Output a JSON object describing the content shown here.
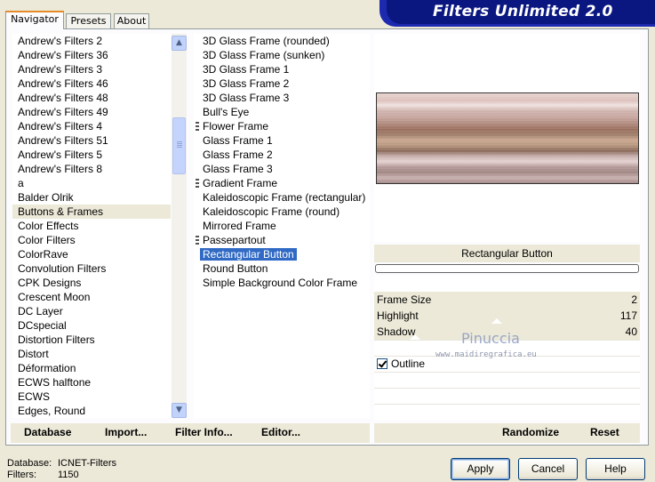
{
  "app": {
    "banner_title": "Filters Unlimited 2.0"
  },
  "tabs": [
    {
      "label": "Navigator"
    },
    {
      "label": "Presets"
    },
    {
      "label": "About"
    }
  ],
  "categories": [
    "Andrew's Filters 2",
    "Andrew's Filters 36",
    "Andrew's Filters 3",
    "Andrew's Filters 46",
    "Andrew's Filters 48",
    "Andrew's Filters 49",
    "Andrew's Filters 4",
    "Andrew's Filters 51",
    "Andrew's Filters 5",
    "Andrew's Filters 8",
    "a",
    "Balder Olrik",
    "Buttons & Frames",
    "Color Effects",
    "Color Filters",
    "ColorRave",
    "Convolution Filters",
    "CPK Designs",
    "Crescent Moon",
    "DC Layer",
    "DCspecial",
    "Distortion Filters",
    "Distort",
    "Déformation",
    "ECWS halftone",
    "ECWS",
    "Edges, Round"
  ],
  "selected_category": "Buttons & Frames",
  "filters": [
    "3D Glass Frame (rounded)",
    "3D Glass Frame (sunken)",
    "3D Glass Frame 1",
    "3D Glass Frame 2",
    "3D Glass Frame 3",
    "Bull's Eye",
    "Flower Frame",
    "Glass Frame 1",
    "Glass Frame 2",
    "Glass Frame 3",
    "Gradient Frame",
    "Kaleidoscopic Frame (rectangular)",
    "Kaleidoscopic Frame (round)",
    "Mirrored Frame",
    "Passepartout",
    "Rectangular Button",
    "Round Button",
    "Simple Background Color Frame"
  ],
  "selected_filter": "Rectangular Button",
  "filter_name": "Rectangular Button",
  "params": [
    {
      "label": "Frame Size",
      "value": "2"
    },
    {
      "label": "Highlight",
      "value": "117"
    },
    {
      "label": "Shadow",
      "value": "40"
    }
  ],
  "outline": {
    "label": "Outline",
    "checked": true
  },
  "watermark": {
    "name": "Pinuccia",
    "url": "www.maidiregrafica.eu"
  },
  "toolbar": {
    "database": "Database",
    "import": "Import...",
    "filter_info": "Filter Info...",
    "editor": "Editor...",
    "randomize": "Randomize",
    "reset": "Reset"
  },
  "status": {
    "database_label": "Database:",
    "database_value": "ICNET-Filters",
    "filters_label": "Filters:",
    "filters_value": "1150"
  },
  "buttons": {
    "apply": "Apply",
    "cancel": "Cancel",
    "help": "Help"
  },
  "colors": {
    "banner": "#0a1780",
    "selection": "#316ac5",
    "tab_accent": "#e68b2c"
  }
}
